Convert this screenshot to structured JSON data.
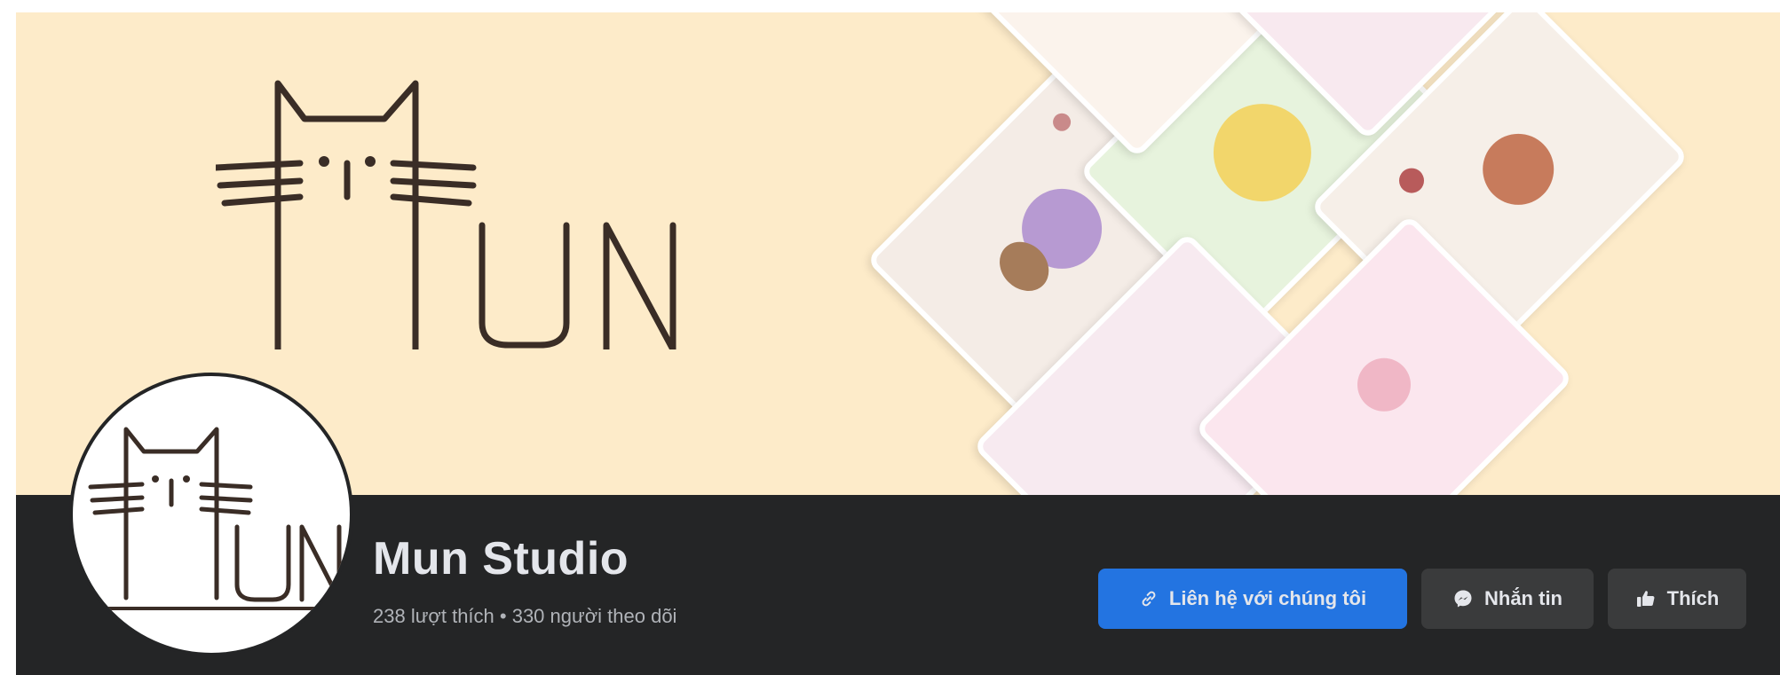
{
  "page": {
    "name": "Mun Studio",
    "stats": "238 lượt thích • 330 người theo dõi",
    "logo_text": "MUN"
  },
  "actions": {
    "contact_label": "Liên hệ với chúng tôi",
    "message_label": "Nhắn tin",
    "like_label": "Thích"
  },
  "icons": {
    "contact": "link-icon",
    "message": "messenger-icon",
    "like": "thumbs-up-icon"
  },
  "colors": {
    "cover_bg": "#fdebc9",
    "bar_bg": "#242526",
    "primary_button": "#2374e1",
    "secondary_button": "#3a3b3c",
    "text_primary": "#e4e6eb",
    "text_secondary": "#b0b3b8"
  }
}
